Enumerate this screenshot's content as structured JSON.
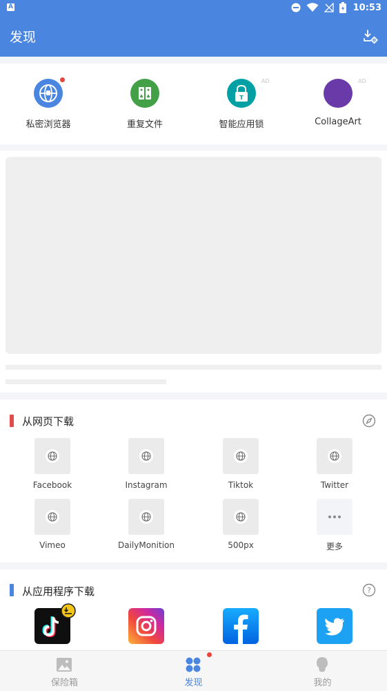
{
  "status_bar": {
    "time": "10:53",
    "indicator_letter": "A",
    "icons": [
      "notification-a-icon",
      "do-not-disturb-icon",
      "wifi-icon",
      "no-signal-icon",
      "battery-icon"
    ]
  },
  "app_bar": {
    "title": "发现",
    "action_icon": "download-settings-icon"
  },
  "tools": [
    {
      "label": "私密浏览器",
      "icon": "private-browser-icon",
      "color": "#4a86e0",
      "badge_dot": true,
      "ad": ""
    },
    {
      "label": "重复文件",
      "icon": "duplicate-files-icon",
      "color": "#43a047",
      "badge_dot": false,
      "ad": ""
    },
    {
      "label": "智能应用锁",
      "icon": "app-lock-icon",
      "color": "#00a0a4",
      "badge_dot": false,
      "ad": "AD"
    },
    {
      "label": "CollageArt",
      "icon": "collageart-icon",
      "color": "#6a3aa8",
      "badge_dot": false,
      "ad": "AD"
    }
  ],
  "web_download": {
    "title": "从网页下载",
    "accent": "#e04b4b",
    "action_icon": "compass-icon",
    "sites": [
      {
        "label": "Facebook"
      },
      {
        "label": "Instagram"
      },
      {
        "label": "Tiktok"
      },
      {
        "label": "Twitter"
      },
      {
        "label": "Vimeo"
      },
      {
        "label": "DailyMonition"
      },
      {
        "label": "500px"
      },
      {
        "label": "更多"
      }
    ]
  },
  "app_download": {
    "title": "从应用程序下载",
    "accent": "#4a86e0",
    "action_icon": "help-circle-icon",
    "apps": [
      "tiktok-app-icon",
      "instagram-app-icon",
      "facebook-app-icon",
      "twitter-app-icon"
    ]
  },
  "bottom_nav": [
    {
      "label": "保险箱",
      "icon": "vault-image-icon",
      "active": false
    },
    {
      "label": "发现",
      "icon": "discover-icon",
      "active": true,
      "badge_dot": true
    },
    {
      "label": "我的",
      "icon": "profile-icon",
      "active": false
    }
  ],
  "colors": {
    "primary": "#4a86e0",
    "badge": "#e8453c",
    "placeholder": "#efefef",
    "inactive_nav": "#9b9b9b"
  }
}
